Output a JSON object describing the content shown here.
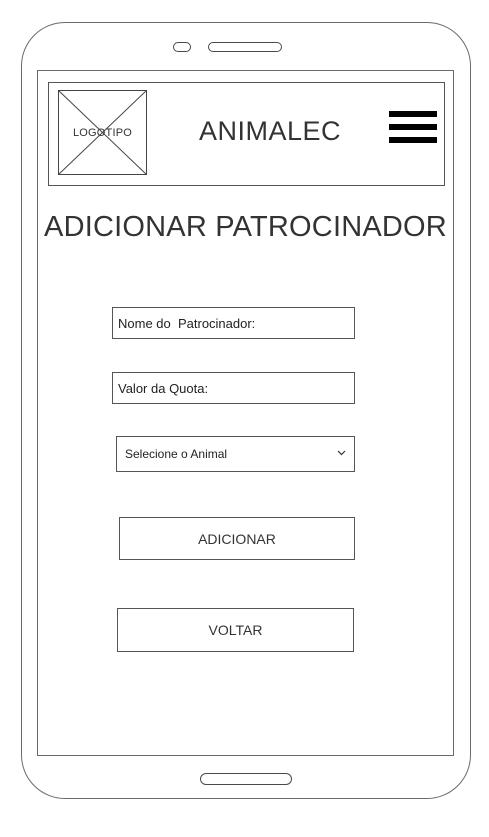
{
  "header": {
    "logo_label": "LOGOTIPO",
    "app_name": "ANIMALEC",
    "menu_icon": "hamburger-menu-icon"
  },
  "page_title": "ADICIONAR PATROCINADOR",
  "form": {
    "sponsor_name_placeholder": "Nome do  Patrocinador:",
    "quota_value_placeholder": "Valor da Quota:",
    "animal_select": {
      "selected": "Selecione o Animal",
      "icon": "chevron-down-icon"
    }
  },
  "buttons": {
    "add_label": "ADICIONAR",
    "back_label": "VOLTAR"
  },
  "colors": {
    "border": "#555555",
    "text": "#333333",
    "menu": "#000000"
  }
}
